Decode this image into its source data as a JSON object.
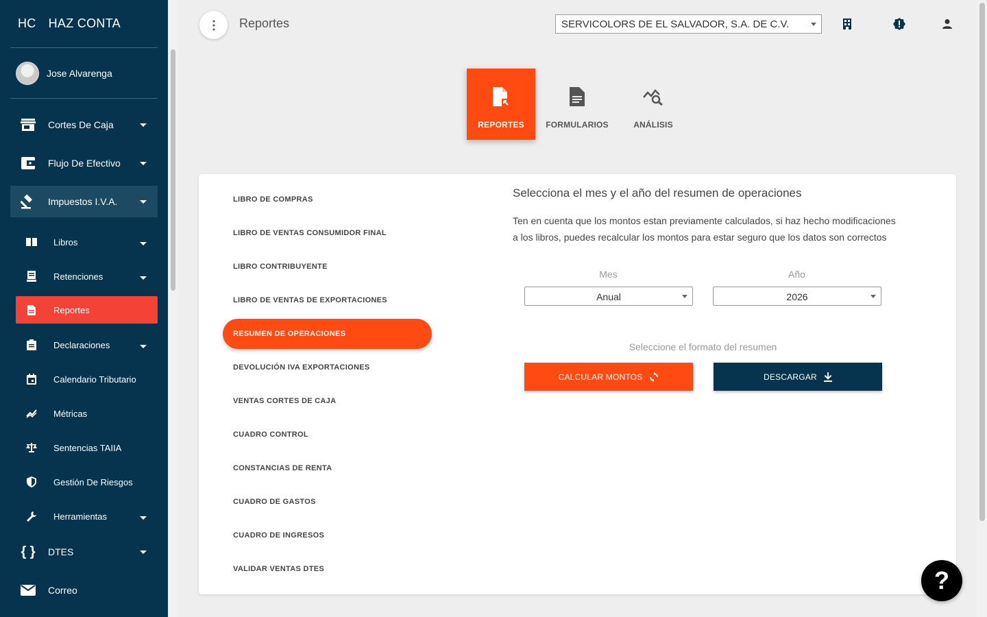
{
  "app": {
    "abbr": "HC",
    "name": "HAZ CONTA"
  },
  "user": {
    "name": "Jose Alvarenga"
  },
  "sidebar": {
    "items": [
      {
        "label": "Cortes De Caja",
        "icon": "store-icon"
      },
      {
        "label": "Flujo De Efectivo",
        "icon": "wallet-icon"
      },
      {
        "label": "Impuestos I.V.A.",
        "icon": "gavel-icon"
      },
      {
        "label": "Libros",
        "icon": "book-icon"
      },
      {
        "label": "Retenciones",
        "icon": "receipt-icon"
      },
      {
        "label": "Reportes",
        "icon": "report-icon"
      },
      {
        "label": "Declaraciones",
        "icon": "clipboard-icon"
      },
      {
        "label": "Calendario Tributario",
        "icon": "calendar-icon"
      },
      {
        "label": "Métricas",
        "icon": "chart-line-icon"
      },
      {
        "label": "Sentencias TAIIA",
        "icon": "scale-icon"
      },
      {
        "label": "Gestión De Riesgos",
        "icon": "shield-icon"
      },
      {
        "label": "Herramientas",
        "icon": "wrench-icon"
      },
      {
        "label": "DTES",
        "icon": "braces-icon"
      },
      {
        "label": "Correo",
        "icon": "mail-icon"
      }
    ]
  },
  "header": {
    "title": "Reportes",
    "company": "SERVICOLORS DE EL SALVADOR, S.A. DE C.V."
  },
  "tabs": [
    {
      "label": "REPORTES"
    },
    {
      "label": "FORMULARIOS"
    },
    {
      "label": "ANÁLISIS"
    }
  ],
  "reports": [
    "LIBRO DE COMPRAS",
    "LIBRO DE VENTAS CONSUMIDOR FINAL",
    "LIBRO CONTRIBUYENTE",
    "LIBRO DE VENTAS DE EXPORTACIONES",
    "RESUMEN DE OPERACIONES",
    "DEVOLUCIÓN IVA EXPORTACIONES",
    "VENTAS CORTES DE CAJA",
    "CUADRO CONTROL",
    "CONSTANCIAS DE RENTA",
    "CUADRO DE GASTOS",
    "CUADRO DE INGRESOS",
    "VALIDAR VENTAS DTES"
  ],
  "summary": {
    "title": "Selecciona el mes y el año del resumen de operaciones",
    "description": "Ten en cuenta que los montos estan previamente calculados, si haz hecho modificaciones a los libros, puedes recalcular los montos para estar seguro que los datos son correctos",
    "month_label": "Mes",
    "month_value": "Anual",
    "year_label": "Año",
    "year_value": "2026",
    "format_label": "Seleccione el formato del resumen",
    "calc_button": "CALCULAR MONTOS",
    "download_button": "DESCARGAR"
  },
  "help": {
    "label": "?"
  },
  "colors": {
    "sidebar": "#06344f",
    "accent": "#ff4a12",
    "active_nav": "#f44336"
  }
}
